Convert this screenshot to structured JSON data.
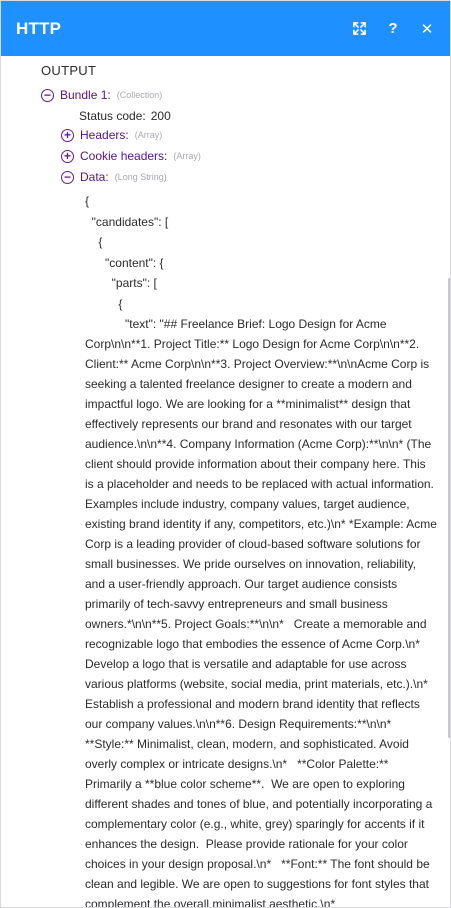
{
  "header": {
    "title": "HTTP",
    "actions": [
      {
        "icon": "expand-icon"
      },
      {
        "icon": "help-icon",
        "label": "?"
      },
      {
        "icon": "close-icon",
        "label": "✕"
      }
    ],
    "color": "#1e90ff"
  },
  "output": {
    "label": "OUTPUT",
    "bundle": {
      "label": "Bundle 1:",
      "type": "(Collection)",
      "toggle": "−"
    },
    "status": {
      "key": "Status code:",
      "value": "200"
    },
    "headers": {
      "key": "Headers:",
      "type": "(Array)",
      "toggle": "+"
    },
    "cookies": {
      "key": "Cookie headers:",
      "type": "(Array)",
      "toggle": "+"
    },
    "data": {
      "key": "Data:",
      "type": "(Long String)",
      "toggle": "−"
    }
  },
  "json_lines": [
    "{",
    "  \"candidates\": [",
    "    {",
    "      \"content\": {",
    "        \"parts\": [",
    "          {"
  ],
  "text_value": "            \"text\": \"## Freelance Brief: Logo Design for Acme Corp\\n\\n**1. Project Title:** Logo Design for Acme Corp\\n\\n**2. Client:** Acme Corp\\n\\n**3. Project Overview:**\\n\\nAcme Corp is seeking a talented freelance designer to create a modern and impactful logo. We are looking for a **minimalist** design that effectively represents our brand and resonates with our target audience.\\n\\n**4. Company Information (Acme Corp):**\\n\\n* (The client should provide information about their company here. This is a placeholder and needs to be replaced with actual information. Examples include industry, company values, target audience, existing brand identity if any, competitors, etc.)\\n* *Example: Acme Corp is a leading provider of cloud-based software solutions for small businesses. We pride ourselves on innovation, reliability, and a user-friendly approach. Our target audience consists primarily of tech-savvy entrepreneurs and small business owners.*\\n\\n**5. Project Goals:**\\n\\n*   Create a memorable and recognizable logo that embodies the essence of Acme Corp.\\n*   Develop a logo that is versatile and adaptable for use across various platforms (website, social media, print materials, etc.).\\n*   Establish a professional and modern brand identity that reflects our company values.\\n\\n**6. Design Requirements:**\\n\\n*   **Style:** Minimalist, clean, modern, and sophisticated. Avoid overly complex or intricate designs.\\n*   **Color Palette:** Primarily a **blue color scheme**.  We are open to exploring different shades and tones of blue, and potentially incorporating a complementary color (e.g., white, grey) sparingly for accents if it enhances the design.  Please provide rationale for your color choices in your design proposal.\\n*   **Font:** The font should be clean and legible. We are open to suggestions for font styles that complement the overall minimalist aesthetic.\\n*"
}
